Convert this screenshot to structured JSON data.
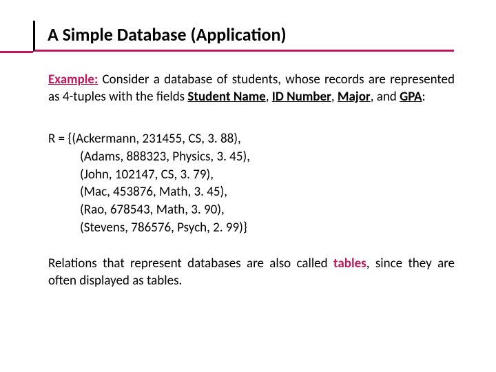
{
  "title": "A Simple Database (Application)",
  "para1": {
    "example_label": "Example:",
    "t1": " Consider a database of students, whose records are represented as 4-tuples with the fields ",
    "f1": "Student Name",
    "c1": ", ",
    "f2": "ID Number",
    "c2": ", ",
    "f3": "Major",
    "c3": ", and ",
    "f4": "GPA",
    "c4": ":"
  },
  "dataset": {
    "lead": "R = {",
    "rows": [
      "(Ackermann, 231455, CS, 3. 88),",
      "(Adams, 888323, Physics, 3. 45),",
      "(John, 102147, CS, 3. 79),",
      "(Mac, 453876, Math, 3. 45),",
      "(Rao, 678543, Math, 3. 90),",
      "(Stevens, 786576, Psych, 2. 99)}"
    ]
  },
  "footer": {
    "t1": "Relations that represent databases are also called ",
    "tbl": "tables",
    "t2": ", since they are often displayed as tables."
  }
}
